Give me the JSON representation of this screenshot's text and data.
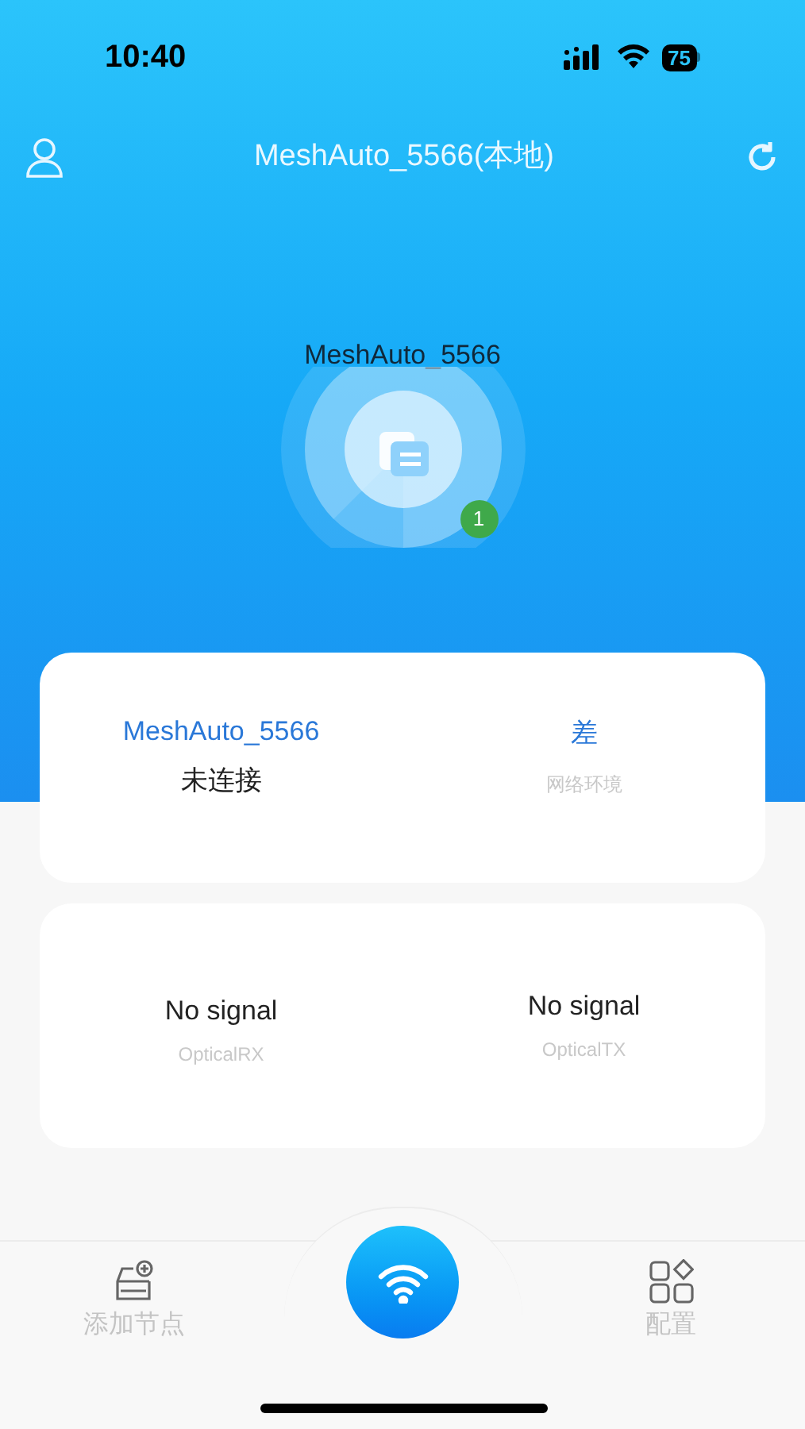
{
  "status_bar": {
    "time": "10:40",
    "battery": "75"
  },
  "nav": {
    "title": "MeshAuto_5566(本地)"
  },
  "device": {
    "name": "MeshAuto_5566",
    "badge": "1"
  },
  "status_card": {
    "name": "MeshAuto_5566",
    "state": "未连接",
    "quality": "差",
    "quality_label": "网络环境"
  },
  "optical_card": [
    {
      "value": "No signal",
      "label": "OpticalRX"
    },
    {
      "value": "No signal",
      "label": "OpticalTX"
    }
  ],
  "tab_bar": [
    {
      "kind": "add",
      "label": "添加节点"
    },
    {
      "kind": "wifi"
    },
    {
      "kind": "config",
      "label": "配置"
    }
  ]
}
